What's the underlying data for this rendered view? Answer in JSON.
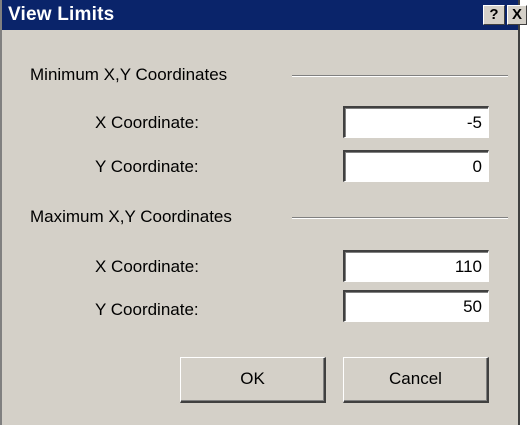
{
  "dialog": {
    "title": "View Limits",
    "help_glyph": "?",
    "close_glyph": "X"
  },
  "minimum": {
    "group_label": "Minimum X,Y Coordinates",
    "x_label": "X Coordinate:",
    "x_value": "-5",
    "y_label": "Y Coordinate:",
    "y_value": "0"
  },
  "maximum": {
    "group_label": "Maximum X,Y Coordinates",
    "x_label": "X Coordinate:",
    "x_value": "110",
    "y_label": "Y Coordinate:",
    "y_value": "50"
  },
  "buttons": {
    "ok_label": "OK",
    "cancel_label": "Cancel"
  }
}
